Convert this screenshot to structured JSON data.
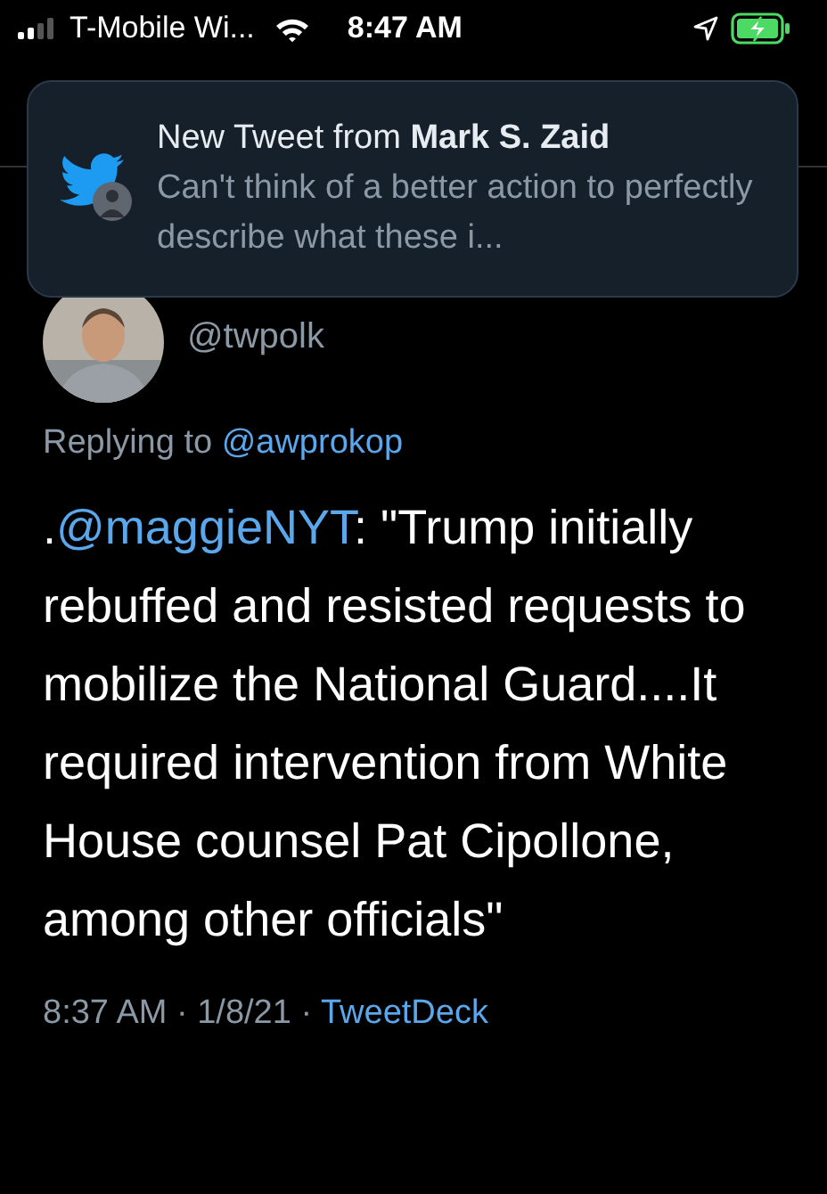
{
  "status_bar": {
    "carrier": "T-Mobile Wi...",
    "time": "8:47 AM"
  },
  "notification": {
    "title_lead": "New Tweet from ",
    "title_name": "Mark S. Zaid",
    "body": "Can't think of a better action to perfectly describe what these i..."
  },
  "tweet": {
    "handle": "@twpolk",
    "reply_label": "Replying to ",
    "reply_to": "@awprokop",
    "text_lead": ".",
    "mention": "@maggieNYT",
    "text": ": \"Trump initially rebuffed and resisted requests to mobilize the National Guard....It required intervention from White House counsel Pat Cipollone, among other officials\"",
    "meta": "8:37 AM · 1/8/21 · ",
    "source": "TweetDeck"
  }
}
